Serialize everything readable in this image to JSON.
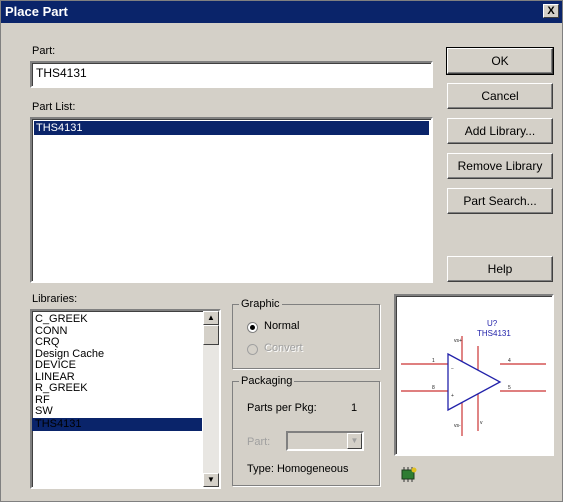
{
  "window": {
    "title": "Place Part",
    "close_glyph": "X"
  },
  "part": {
    "label": "Part:",
    "value": "THS4131"
  },
  "part_list": {
    "label": "Part List:",
    "items": [
      "THS4131"
    ]
  },
  "buttons": {
    "ok": "OK",
    "cancel": "Cancel",
    "add_library": "Add Library...",
    "remove_library": "Remove Library",
    "part_search": "Part Search...",
    "help": "Help"
  },
  "libraries": {
    "label": "Libraries:",
    "items": [
      "C_GREEK",
      "CONN",
      "CRQ",
      "Design Cache",
      "DEVICE",
      "LINEAR",
      "R_GREEK",
      "RF",
      "SW",
      "THS4131"
    ],
    "selected": "THS4131"
  },
  "graphic": {
    "label": "Graphic",
    "normal": "Normal",
    "convert": "Convert",
    "selected": "Normal"
  },
  "packaging": {
    "label": "Packaging",
    "parts_per_pkg_label": "Parts per Pkg:",
    "parts_per_pkg_value": "1",
    "part_label": "Part:",
    "type_text": "Type: Homogeneous"
  },
  "preview": {
    "ref": "U?",
    "name": "THS4131"
  },
  "colors": {
    "titlebar": "#0a246a",
    "dialog": "#d4d0c8",
    "pin_lines": "#cc3333",
    "symbol": "#2222aa"
  }
}
